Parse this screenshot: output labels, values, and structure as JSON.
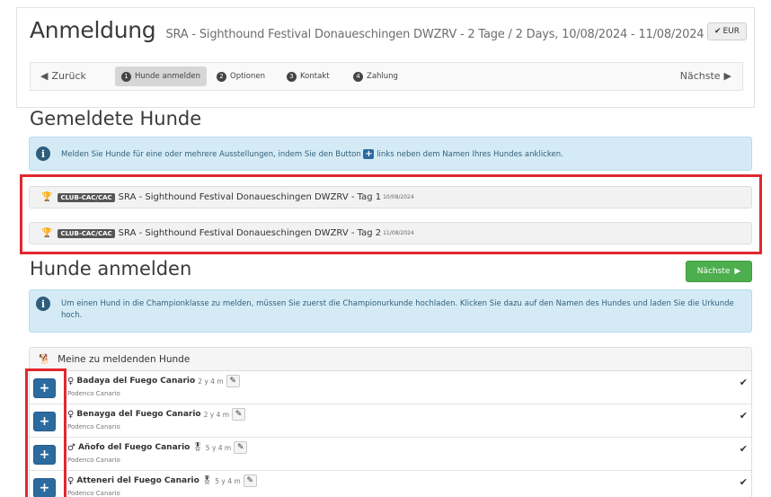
{
  "header": {
    "title": "Anmeldung",
    "subtitle": "SRA - Sighthound Festival Donaueschingen DWZRV - 2 Tage / 2 Days, 10/08/2024 - 11/08/2024",
    "currency_button": "EUR"
  },
  "wizard": {
    "back_label": "Zurück",
    "next_label": "Nächste",
    "steps": [
      {
        "num": "1",
        "label": "Hunde anmelden",
        "active": true
      },
      {
        "num": "2",
        "label": "Optionen",
        "active": false
      },
      {
        "num": "3",
        "label": "Kontakt",
        "active": false
      },
      {
        "num": "4",
        "label": "Zahlung",
        "active": false
      }
    ]
  },
  "registered": {
    "title": "Gemeldete Hunde",
    "info_before": "Melden Sie Hunde für eine oder mehrere Ausstellungen, indem Sie den Button",
    "info_after": "links neben dem Namen Ihres Hundes anklicken.",
    "shows": [
      {
        "badge": "CLUB-CAC/CAC",
        "name": "SRA - Sighthound Festival Donaueschingen DWZRV - Tag 1",
        "date": "10/08/2024"
      },
      {
        "badge": "CLUB-CAC/CAC",
        "name": "SRA - Sighthound Festival Donaueschingen DWZRV - Tag 2",
        "date": "11/08/2024"
      }
    ]
  },
  "register": {
    "title": "Hunde anmelden",
    "next_label": "Nächste",
    "info": "Um einen Hund in die Championklasse zu melden, müssen Sie zuerst die Championurkunde hochladen. Klicken Sie dazu auf den Namen des Hundes und laden Sie die Urkunde hoch.",
    "panel_title": "Meine zu meldenden Hunde",
    "dogs": [
      {
        "sex": "♀",
        "name": "Badaya del Fuego Canario",
        "champion": false,
        "age": "2 y 4 m",
        "breed": "Podenco Canario"
      },
      {
        "sex": "♀",
        "name": "Benayga del Fuego Canario",
        "champion": false,
        "age": "2 y 4 m",
        "breed": "Podenco Canario"
      },
      {
        "sex": "♂",
        "name": "Añofo del Fuego Canario",
        "champion": true,
        "age": "5 y 4 m",
        "breed": "Podenco Canario"
      },
      {
        "sex": "♀",
        "name": "Atteneri del Fuego Canario",
        "champion": true,
        "age": "5 y 4 m",
        "breed": "Podenco Canario"
      }
    ]
  },
  "colors": {
    "primary": "#2c6ba0",
    "success": "#4cae4c",
    "info_bg": "#d4ebf6",
    "highlight": "#e0282e"
  },
  "icons": {
    "back": "chevron-left-icon",
    "next": "chevron-right-icon",
    "info": "info-circle-icon",
    "trophy": "trophy-icon",
    "dog": "dog-icon",
    "champion": "award-ribbon-icon",
    "edit": "pencil-icon",
    "check": "checkmark-icon",
    "add": "plus-icon"
  }
}
